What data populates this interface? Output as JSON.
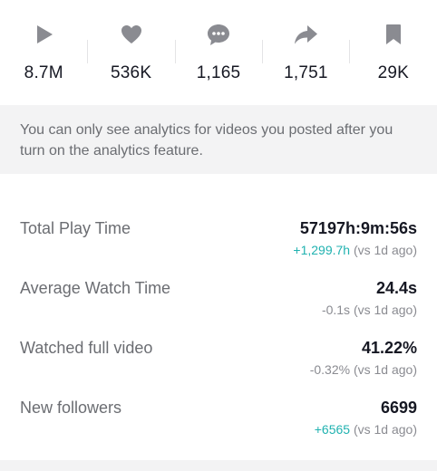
{
  "stats": [
    {
      "icon": "play-icon",
      "value": "8.7M"
    },
    {
      "icon": "heart-icon",
      "value": "536K"
    },
    {
      "icon": "comment-icon",
      "value": "1,165"
    },
    {
      "icon": "share-icon",
      "value": "1,751"
    },
    {
      "icon": "bookmark-icon",
      "value": "29K"
    }
  ],
  "notice": "You can only see analytics for videos you posted after you turn on the analytics feature.",
  "metrics": {
    "total_play_time": {
      "label": "Total Play Time",
      "value": "57197h:9m:56s",
      "delta": "+1,299.7h",
      "delta_suffix": " (vs 1d ago)"
    },
    "average_watch_time": {
      "label": "Average Watch Time",
      "value": "24.4s",
      "delta": "-0.1s (vs 1d ago)"
    },
    "watched_full_video": {
      "label": "Watched full video",
      "value": "41.22%",
      "delta": "-0.32% (vs 1d ago)"
    },
    "new_followers": {
      "label": "New followers",
      "value": "6699",
      "delta": "+6565",
      "delta_suffix": " (vs 1d ago)"
    }
  },
  "colors": {
    "positive_delta": "#20b2b0",
    "icon_gray": "#8a8b91",
    "notice_bg": "#f3f3f4"
  }
}
